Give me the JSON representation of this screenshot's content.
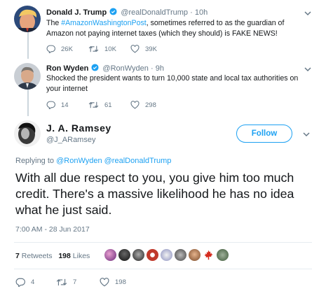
{
  "tweet1": {
    "name": "Donald J. Trump",
    "handle": "@realDonaldTrump",
    "sep": "·",
    "time": "10h",
    "link_text": "#AmazonWashingtonPost",
    "text_before": "The ",
    "text_after": ", sometimes referred to as the guardian of Amazon not paying internet taxes (which they should) is FAKE NEWS!",
    "replies": "26K",
    "retweets": "10K",
    "likes": "39K"
  },
  "tweet2": {
    "name": "Ron Wyden",
    "handle": "@RonWyden",
    "sep": "·",
    "time": "9h",
    "text": "Shocked the president wants to turn 10,000 state and local tax authorities on your internet",
    "replies": "14",
    "retweets": "61",
    "likes": "298"
  },
  "main": {
    "name": "J. A. Ramsey",
    "handle": "@J_ARamsey",
    "follow_label": "Follow",
    "reply_prefix": "Replying to ",
    "reply_users": "@RonWyden @realDonaldTrump",
    "text": "With all due respect to you, you give him too much credit. There's a massive likelihood he has no idea what he just said.",
    "timestamp": "7:00 AM - 28 Jun 2017",
    "retweets_count": "7",
    "retweets_label": "Retweets",
    "likes_count": "198",
    "likes_label": "Likes",
    "replies": "4",
    "retweets": "7",
    "likes": "198"
  },
  "colors": {
    "accent": "#1da1f2",
    "muted": "#657786",
    "text": "#14171a",
    "divider": "#e6ecf0"
  },
  "icons": [
    "verified-icon",
    "chevron-down-icon",
    "reply-icon",
    "retweet-icon",
    "like-icon"
  ]
}
